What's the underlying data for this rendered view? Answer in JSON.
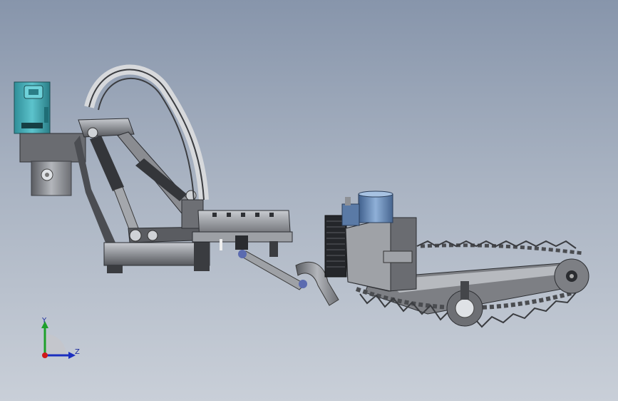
{
  "viewport": {
    "background_top": "#8795ab",
    "background_bottom": "#c9cfd8"
  },
  "model": {
    "colors": {
      "steel": "#7d7f84",
      "steel_light": "#b9bcc1",
      "steel_dark": "#3c3e43",
      "teal_box": "#3fa6b0",
      "blue_tank": "#5f7ea8",
      "chain": "#4a4c50",
      "hose": "#2f3034"
    }
  },
  "triad": {
    "x_label": "",
    "y_label": "Y",
    "z_label": "Z",
    "y_color": "#1ea02a",
    "z_color": "#1b2fbf",
    "origin_color": "#d01818"
  }
}
